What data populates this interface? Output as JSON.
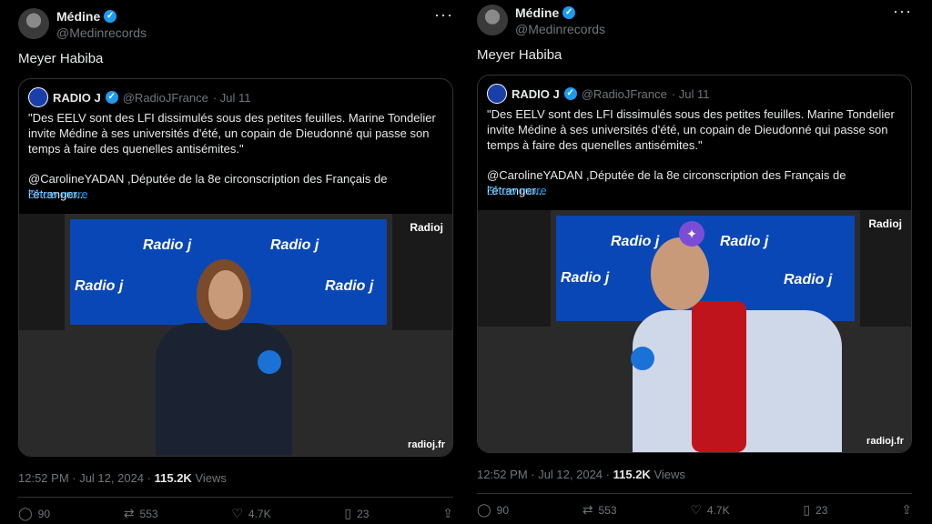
{
  "tweets": [
    {
      "author": {
        "name": "Médine",
        "handle": "@Medinrecords"
      },
      "text": "Meyer Habiba",
      "quote": {
        "name": "RADIO J",
        "handle": "@RadioJFrance",
        "date": "· Jul 11",
        "body1": "\"Des EELV sont des LFI dissimulés sous des petites feuilles. Marine Tondelier invite Médine à ses universités d'été, un copain de Dieudonné qui passe son temps à faire des quenelles antisémites.\"",
        "body2": "@CarolineYADAN ,Députée de la 8e circonscription des Français de l'étranger...",
        "show_more": "Show more",
        "media_brand": "radioj.fr",
        "media_top": "Radioj"
      },
      "time": "12:52 PM · Jul 12, 2024 ·",
      "views": "115.2K",
      "views_label": "Views",
      "actions": {
        "reply": "90",
        "repost": "553",
        "like": "4.7K",
        "bookmark": "23"
      }
    },
    {
      "author": {
        "name": "Médine",
        "handle": "@Medinrecords"
      },
      "text": "Meyer Habiba",
      "quote": {
        "name": "RADIO J",
        "handle": "@RadioJFrance",
        "date": "· Jul 11",
        "body1": "\"Des EELV sont des LFI dissimulés sous des petites feuilles. Marine Tondelier invite Médine à ses universités d'été, un copain de Dieudonné qui passe son temps à faire des quenelles antisémites.\"",
        "body2": "@CarolineYADAN ,Députée de la 8e circonscription des Français de l'étranger...",
        "show_more": "Show more",
        "media_brand": "radioj.fr",
        "media_top": "Radioj"
      },
      "time": "12:52 PM · Jul 12, 2024 ·",
      "views": "115.2K",
      "views_label": "Views",
      "actions": {
        "reply": "90",
        "repost": "553",
        "like": "4.7K",
        "bookmark": "23"
      }
    }
  ],
  "icons": {
    "verified": "verified-badge-icon",
    "more": "more-icon",
    "reply": "reply-icon",
    "repost": "repost-icon",
    "like": "like-icon",
    "bookmark": "bookmark-icon",
    "share": "share-icon"
  }
}
